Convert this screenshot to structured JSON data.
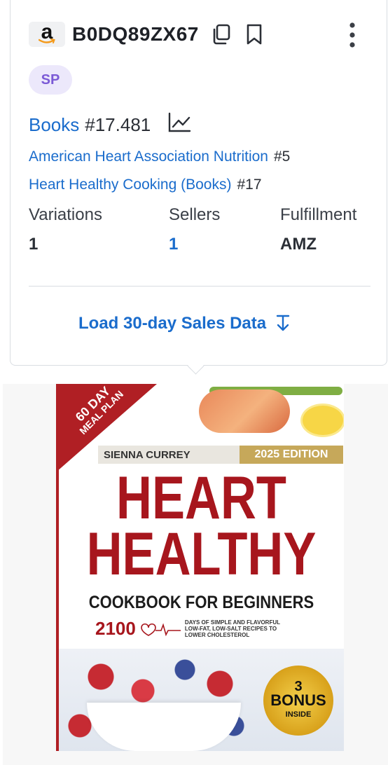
{
  "product": {
    "asin": "B0DQ89ZX67",
    "badge": "SP",
    "main_category": "Books",
    "main_rank": "#17.481",
    "sub_ranks": [
      {
        "category": "American Heart Association Nutrition",
        "rank": "#5"
      },
      {
        "category": "Heart Healthy Cooking (Books)",
        "rank": "#17"
      }
    ],
    "stats": [
      {
        "label": "Variations",
        "value": "1"
      },
      {
        "label": "Sellers",
        "value": "1"
      },
      {
        "label": "Fulfillment",
        "value": "AMZ"
      }
    ],
    "load_button": "Load 30-day Sales Data"
  },
  "cover": {
    "banner_top": "60 DAY",
    "banner_bottom": "MEAL PLAN",
    "author": "SIENNA CURREY",
    "edition": "2025 EDITION",
    "title_line1": "HEART",
    "title_line2": "HEALTHY",
    "subtitle": "COOKBOOK FOR BEGINNERS",
    "recipes_number": "2100",
    "recipes_text": "DAYS OF SIMPLE AND FLAVORFUL LOW-FAT, LOW-SALT RECIPES TO LOWER CHOLESTEROL",
    "bonus_number": "3",
    "bonus_label": "BONUS",
    "bonus_sub": "INSIDE"
  },
  "icons": {
    "logo": "amazon-logo",
    "copy": "copy-icon",
    "bookmark": "bookmark-icon",
    "more": "more-vertical-icon",
    "trend": "trend-chart-icon",
    "download": "arrow-down-icon"
  },
  "colors": {
    "link": "#1a6ccc",
    "badge_bg": "#ece8fb",
    "badge_text": "#7b5ad6",
    "cover_red": "#a7161d"
  }
}
